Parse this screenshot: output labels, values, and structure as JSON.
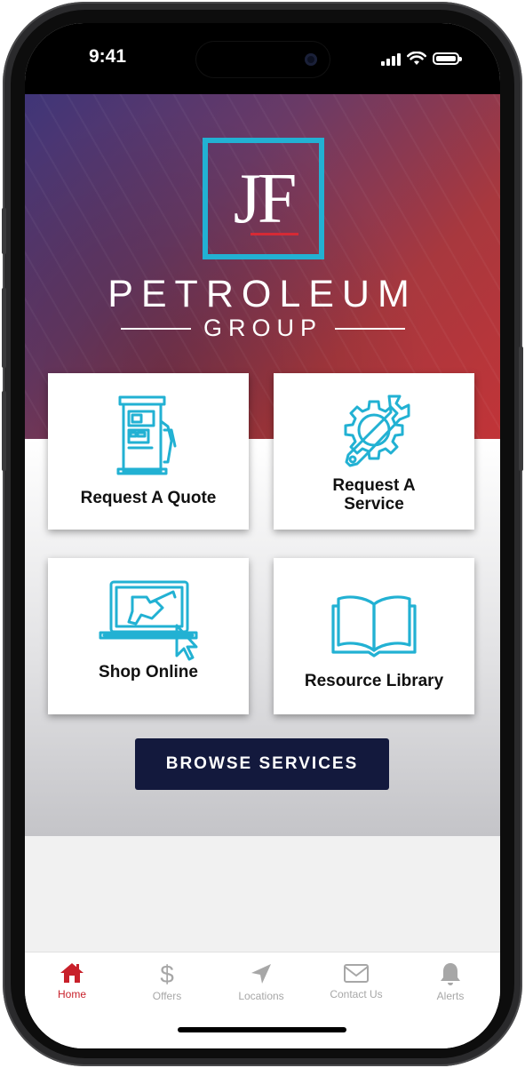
{
  "status_bar": {
    "time": "9:41"
  },
  "brand": {
    "logo_initials": "JF",
    "name": "PETROLEUM",
    "sub": "GROUP"
  },
  "tiles": [
    {
      "label": "Request A Quote",
      "icon": "fuel-pump-icon"
    },
    {
      "label": "Request A Service",
      "icon": "gear-wrench-icon"
    },
    {
      "label": "Shop Online",
      "icon": "laptop-fuel-nozzle-icon"
    },
    {
      "label": "Resource Library",
      "icon": "open-book-icon"
    }
  ],
  "browse_button": {
    "label": "BROWSE SERVICES"
  },
  "tab_bar": {
    "items": [
      {
        "label": "Home",
        "icon": "home-icon",
        "active": true
      },
      {
        "label": "Offers",
        "icon": "dollar-icon",
        "active": false
      },
      {
        "label": "Locations",
        "icon": "location-arrow-icon",
        "active": false
      },
      {
        "label": "Contact Us",
        "icon": "envelope-icon",
        "active": false
      },
      {
        "label": "Alerts",
        "icon": "bell-icon",
        "active": false
      }
    ]
  },
  "colors": {
    "accent_cyan": "#22b1d3",
    "brand_red": "#c8202a",
    "button_navy": "#13193d"
  }
}
